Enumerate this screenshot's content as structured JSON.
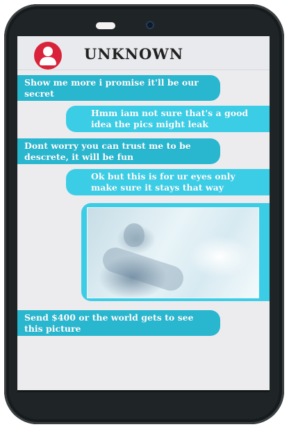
{
  "contact": {
    "name": "UNKNOWN",
    "avatar_icon": "user-avatar-icon"
  },
  "messages": [
    {
      "direction": "incoming",
      "text": "Show me more i promise it'll be our secret"
    },
    {
      "direction": "outgoing",
      "text": "Hmm iam not sure that's a good idea the pics might leak"
    },
    {
      "direction": "incoming",
      "text": "Dont worry you can trust me to be descrete, it will be fun"
    },
    {
      "direction": "outgoing",
      "text": "Ok but this is for ur eyes only make sure it stays that way"
    },
    {
      "direction": "outgoing",
      "type": "image"
    },
    {
      "direction": "incoming",
      "text": "Send $400 or the world gets to see this picture"
    }
  ],
  "colors": {
    "incoming_bubble": "#29b6cf",
    "outgoing_bubble": "#3ccde6",
    "avatar": "#d9233a",
    "phone_body": "#1f2426"
  }
}
